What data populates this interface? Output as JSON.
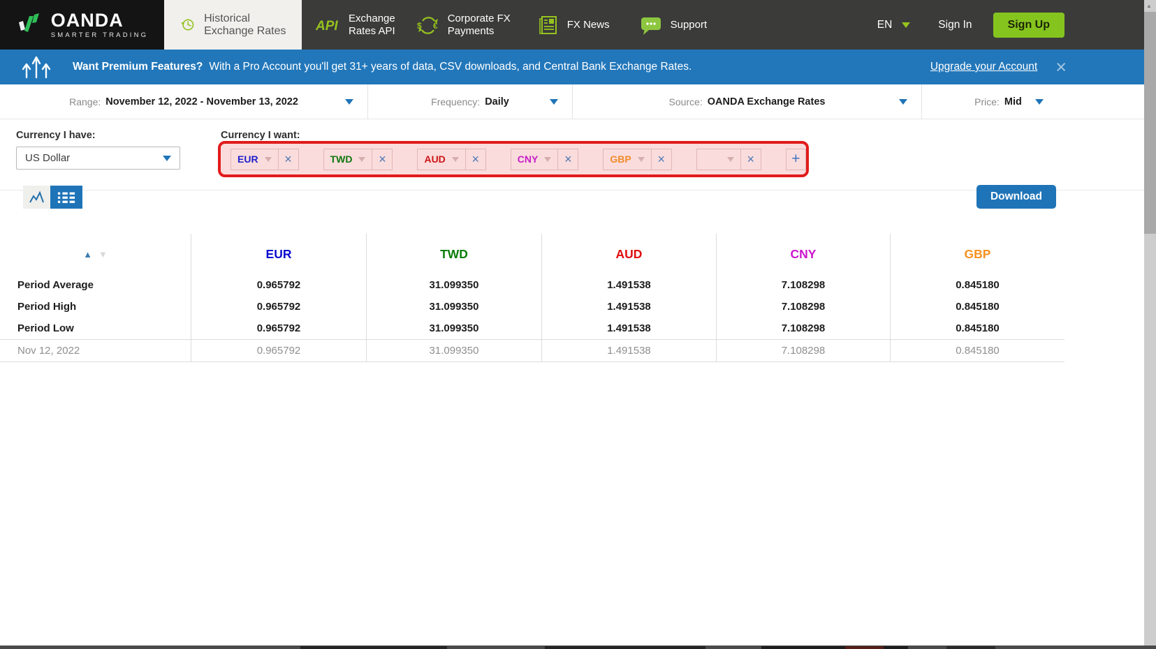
{
  "nav": {
    "brand": "OANDA",
    "tagline": "SMARTER TRADING",
    "items": [
      {
        "lines": [
          "Historical",
          "Exchange Rates"
        ],
        "icon": "history-clock-icon",
        "active": true
      },
      {
        "lines": [
          "Exchange",
          "Rates API"
        ],
        "icon": "api-icon",
        "active": false
      },
      {
        "lines": [
          "Corporate FX",
          "Payments"
        ],
        "icon": "currency-cycle-icon",
        "active": false
      },
      {
        "lines": [
          "FX News"
        ],
        "icon": "newspaper-icon",
        "active": false
      },
      {
        "lines": [
          "Support"
        ],
        "icon": "chat-bubble-icon",
        "active": false
      }
    ],
    "language": "EN",
    "sign_in_label": "Sign In",
    "sign_up_label": "Sign Up"
  },
  "banner": {
    "headline": "Want Premium Features?",
    "message": "With a Pro Account you'll get 31+ years of data, CSV downloads, and Central Bank Exchange Rates.",
    "link_label": "Upgrade your Account",
    "close_icon": "×"
  },
  "filters": {
    "items": [
      {
        "label": "Range:",
        "value": "November 12, 2022 - November 13, 2022"
      },
      {
        "label": "Frequency:",
        "value": "Daily"
      },
      {
        "label": "Source:",
        "value": "OANDA Exchange Rates"
      },
      {
        "label": "Price:",
        "value": "Mid"
      }
    ]
  },
  "converter": {
    "have_label": "Currency I have:",
    "have_value": "US Dollar",
    "want_label": "Currency I want:",
    "chips": [
      {
        "code": "EUR",
        "color": "#2020cc"
      },
      {
        "code": "TWD",
        "color": "#107710"
      },
      {
        "code": "AUD",
        "color": "#cc1515"
      },
      {
        "code": "CNY",
        "color": "#c81ec8"
      },
      {
        "code": "GBP",
        "color": "#ef8b2d"
      }
    ],
    "remove_icon": "×",
    "add_icon": "+"
  },
  "toolbar": {
    "download_label": "Download"
  },
  "table": {
    "sort_up_icon": "▲",
    "sort_down_icon": "▼",
    "columns": [
      {
        "code": "EUR",
        "color": "#0b0bd0"
      },
      {
        "code": "TWD",
        "color": "#0a7d0a"
      },
      {
        "code": "AUD",
        "color": "#e00d0d"
      },
      {
        "code": "CNY",
        "color": "#cc14cc"
      },
      {
        "code": "GBP",
        "color": "#f6921e"
      }
    ],
    "rows": [
      {
        "label": "Period Average",
        "values": [
          "0.965792",
          "31.099350",
          "1.491538",
          "7.108298",
          "0.845180"
        ]
      },
      {
        "label": "Period High",
        "values": [
          "0.965792",
          "31.099350",
          "1.491538",
          "7.108298",
          "0.845180"
        ]
      },
      {
        "label": "Period Low",
        "values": [
          "0.965792",
          "31.099350",
          "1.491538",
          "7.108298",
          "0.845180"
        ]
      },
      {
        "label": "Nov 12, 2022",
        "values": [
          "0.965792",
          "31.099350",
          "1.491538",
          "7.108298",
          "0.845180"
        ],
        "muted": true
      }
    ]
  },
  "colors": {
    "accent_blue": "#1f74b8",
    "banner_blue": "#2277ba",
    "brand_green": "#96c31e",
    "highlight_red": "#e21b1b"
  }
}
